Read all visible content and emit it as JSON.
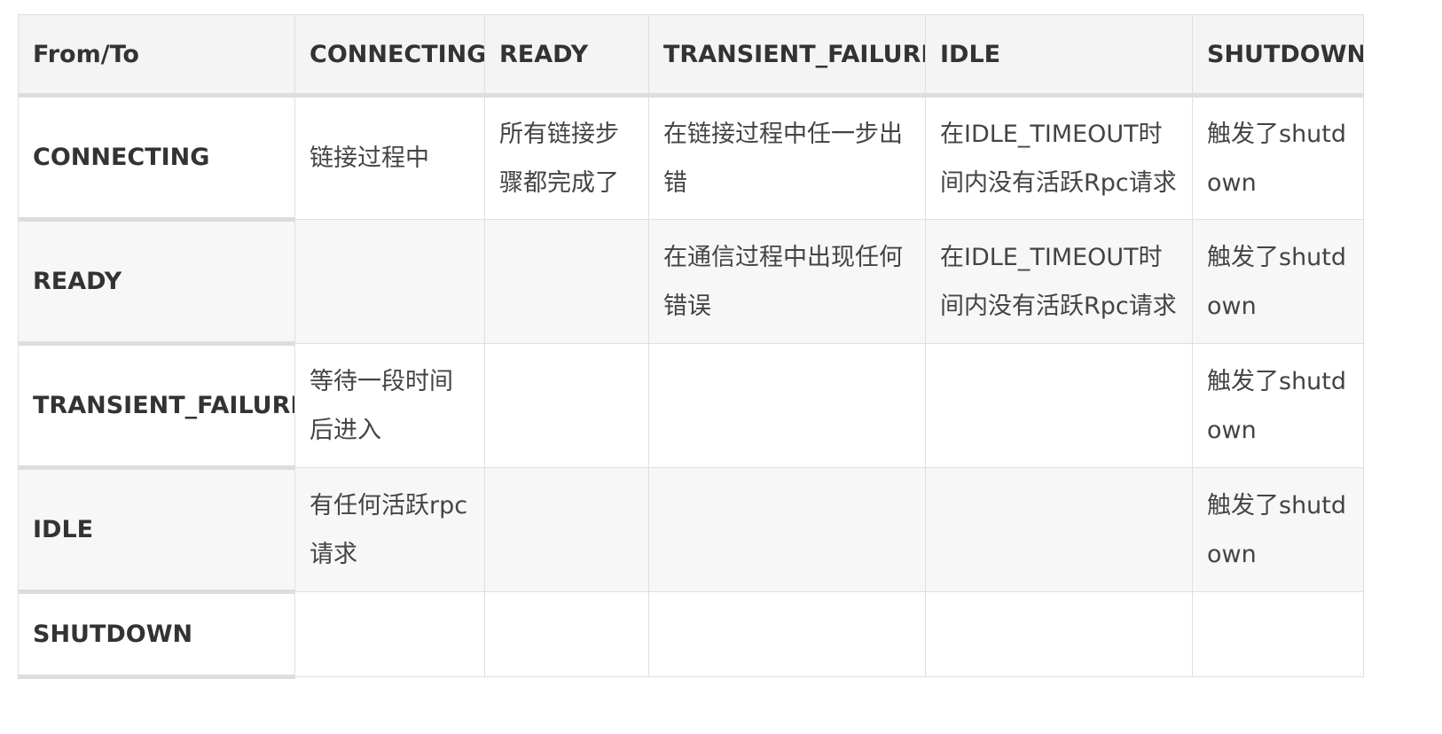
{
  "table": {
    "header": [
      "From/To",
      "CONNECTING",
      "READY",
      "TRANSIENT_FAILURE",
      "IDLE",
      "SHUTDOWN"
    ],
    "rows": [
      {
        "label": "CONNECTING",
        "cells": [
          "链接过程中",
          "所有链接步骤都完成了",
          "在链接过程中任一步出错",
          "在IDLE_TIMEOUT时间内没有活跃Rpc请求",
          "触发了shutdown"
        ]
      },
      {
        "label": "READY",
        "cells": [
          "",
          "",
          "在通信过程中出现任何错误",
          "在IDLE_TIMEOUT时间内没有活跃Rpc请求",
          "触发了shutdown"
        ]
      },
      {
        "label": "TRANSIENT_FAILURE",
        "cells": [
          "等待一段时间后进入",
          "",
          "",
          "",
          "触发了shutdown"
        ]
      },
      {
        "label": "IDLE",
        "cells": [
          "有任何活跃rpc请求",
          "",
          "",
          "",
          "触发了shutdown"
        ]
      },
      {
        "label": "SHUTDOWN",
        "cells": [
          "",
          "",
          "",
          "",
          ""
        ]
      }
    ]
  }
}
